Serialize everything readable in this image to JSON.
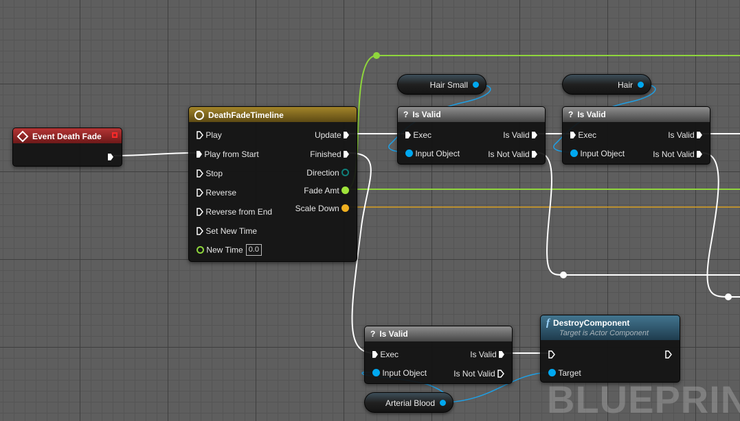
{
  "watermark": "BLUEPRINT",
  "colors": {
    "exec_wire": "#ffffff",
    "object_pin": "#00a8f0",
    "float_pin": "#9fe33a",
    "bool_or_struct_pin": "#f0b020",
    "direction_pin": "#0f7f7a"
  },
  "nodes": {
    "event_death_fade": {
      "title": "Event Death Fade",
      "icon": "event-diamond-icon"
    },
    "timeline": {
      "title": "DeathFadeTimeline",
      "icon": "clock-icon",
      "inputs": [
        "Play",
        "Play from Start",
        "Stop",
        "Reverse",
        "Reverse from End",
        "Set New Time"
      ],
      "new_time_label": "New Time",
      "new_time_value": "0.0",
      "outputs": {
        "update": "Update",
        "finished": "Finished",
        "direction": "Direction",
        "fade_amt": "Fade Amt",
        "scale_down": "Scale Down"
      }
    },
    "is_valid_1": {
      "title": "Is Valid",
      "icon": "question-icon",
      "exec": "Exec",
      "input_object": "Input Object",
      "is_valid": "Is Valid",
      "is_not_valid": "Is Not Valid"
    },
    "is_valid_2": {
      "title": "Is Valid",
      "icon": "question-icon",
      "exec": "Exec",
      "input_object": "Input Object",
      "is_valid": "Is Valid",
      "is_not_valid": "Is Not Valid"
    },
    "is_valid_3": {
      "title": "Is Valid",
      "icon": "question-icon",
      "exec": "Exec",
      "input_object": "Input Object",
      "is_valid": "Is Valid",
      "is_not_valid": "Is Not Valid"
    },
    "destroy_component": {
      "title": "DestroyComponent",
      "subtitle": "Target is Actor Component",
      "icon": "function-icon",
      "target": "Target"
    },
    "vars": {
      "hair_small": "Hair Small",
      "hair": "Hair",
      "arterial_blood": "Arterial Blood"
    }
  }
}
